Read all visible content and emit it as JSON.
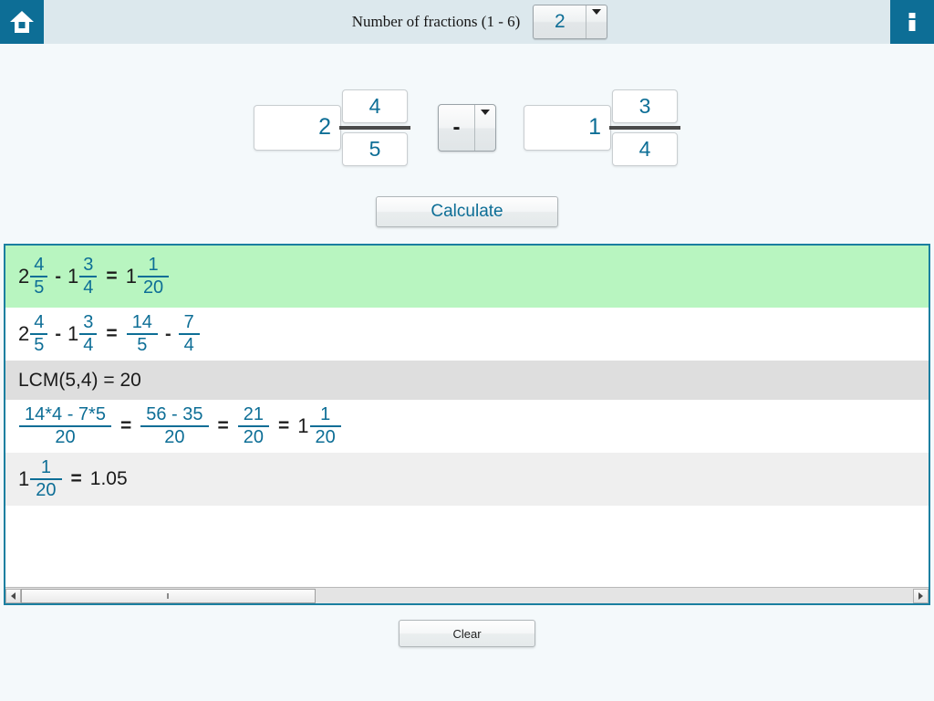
{
  "header": {
    "home_icon": "home-icon",
    "info_icon": "info-icon",
    "label": "Number of fractions (1 - 6)",
    "fraction_count": "2",
    "dropdown_icon": "chevron-down-icon"
  },
  "inputs": {
    "term1": {
      "whole": "2",
      "numerator": "4",
      "denominator": "5"
    },
    "operator": "-",
    "operator_dropdown_icon": "chevron-down-icon",
    "term2": {
      "whole": "1",
      "numerator": "3",
      "denominator": "4"
    }
  },
  "buttons": {
    "calculate": "Calculate",
    "clear": "Clear"
  },
  "results": {
    "row_result": {
      "t1_whole": "2",
      "t1_num": "4",
      "t1_den": "5",
      "op": "-",
      "t2_whole": "1",
      "t2_num": "3",
      "t2_den": "4",
      "eq": "=",
      "r_whole": "1",
      "r_num": "1",
      "r_den": "20"
    },
    "row_improper": {
      "t1_whole": "2",
      "t1_num": "4",
      "t1_den": "5",
      "op": "-",
      "t2_whole": "1",
      "t2_num": "3",
      "t2_den": "4",
      "eq": "=",
      "i1_num": "14",
      "i1_den": "5",
      "op2": "-",
      "i2_num": "7",
      "i2_den": "4"
    },
    "row_lcm": "LCM(5,4) = 20",
    "row_work": {
      "s1_num": "14*4 - 7*5",
      "s1_den": "20",
      "eq1": "=",
      "s2_num": "56 - 35",
      "s2_den": "20",
      "eq2": "=",
      "s3_num": "21",
      "s3_den": "20",
      "eq3": "=",
      "m_whole": "1",
      "m_num": "1",
      "m_den": "20"
    },
    "row_decimal": {
      "whole": "1",
      "num": "1",
      "den": "20",
      "eq": "=",
      "value": "1.05"
    }
  },
  "scrollbar": {
    "left_arrow_icon": "arrow-left-icon",
    "right_arrow_icon": "arrow-right-icon"
  },
  "colors": {
    "accent": "#0d6e96",
    "header_band": "#dce8ed",
    "result_highlight": "#b8f5c0",
    "panel_border": "#1a7fa0"
  }
}
